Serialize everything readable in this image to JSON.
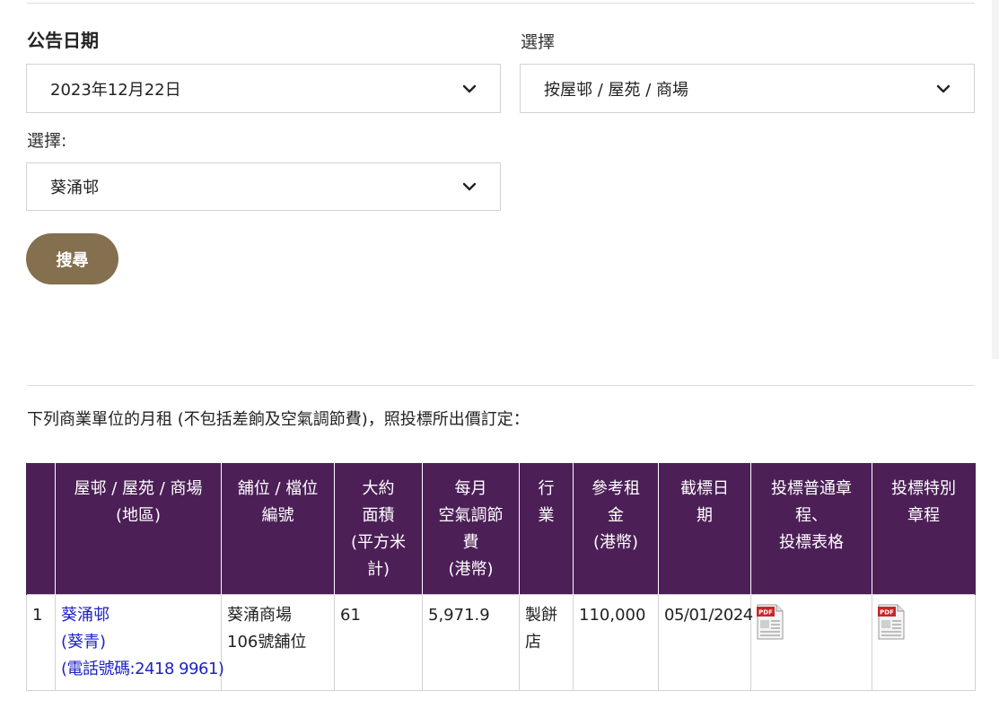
{
  "form": {
    "date_label": "公告日期",
    "date_value": "2023年12月22日",
    "select1_label": "選擇",
    "select1_value": "按屋邨 / 屋苑 / 商場",
    "select2_label": "選擇:",
    "select2_value": "葵涌邨",
    "search_label": "搜尋"
  },
  "intro_text": "下列商業單位的月租 (不包括差餉及空氣調節費)，照投標所出價訂定：",
  "table": {
    "headers": [
      [],
      [
        "屋邨 / 屋苑 / 商場",
        "(地區)"
      ],
      [
        "舖位 / 檔位",
        "編號"
      ],
      [
        "大約",
        "面積",
        "(平方米",
        "計)"
      ],
      [
        "每月",
        "空氣調節",
        "費",
        "(港幣)"
      ],
      [
        "行",
        "業"
      ],
      [
        "參考租",
        "金",
        "(港幣)"
      ],
      [
        "截標日",
        "期"
      ],
      [
        "投標普通章",
        "程、",
        "投標表格"
      ],
      [
        "投標特別",
        "章程"
      ]
    ],
    "row": {
      "index": "1",
      "estate_name": "葵涌邨",
      "district": "(葵青)",
      "phone": "(電話號碼:2418 9961)",
      "shop_line1": "葵涌商場",
      "shop_line2": "106號舖位",
      "area": "61",
      "ac_fee": "5,971.9",
      "trade_line1": "製餅",
      "trade_line2": "店",
      "ref_rent": "110,000",
      "closing_date": "05/01/2024",
      "pdf_badge": "PDF"
    }
  },
  "icons": {
    "select_chevron": "chevron-down-icon",
    "tender_general": "pdf-icon",
    "tender_special": "pdf-icon"
  },
  "colors": {
    "header_purple": "#4c1f57",
    "button_brown": "#84704f",
    "link_blue": "#1f22c6",
    "pdf_red": "#c62828"
  }
}
